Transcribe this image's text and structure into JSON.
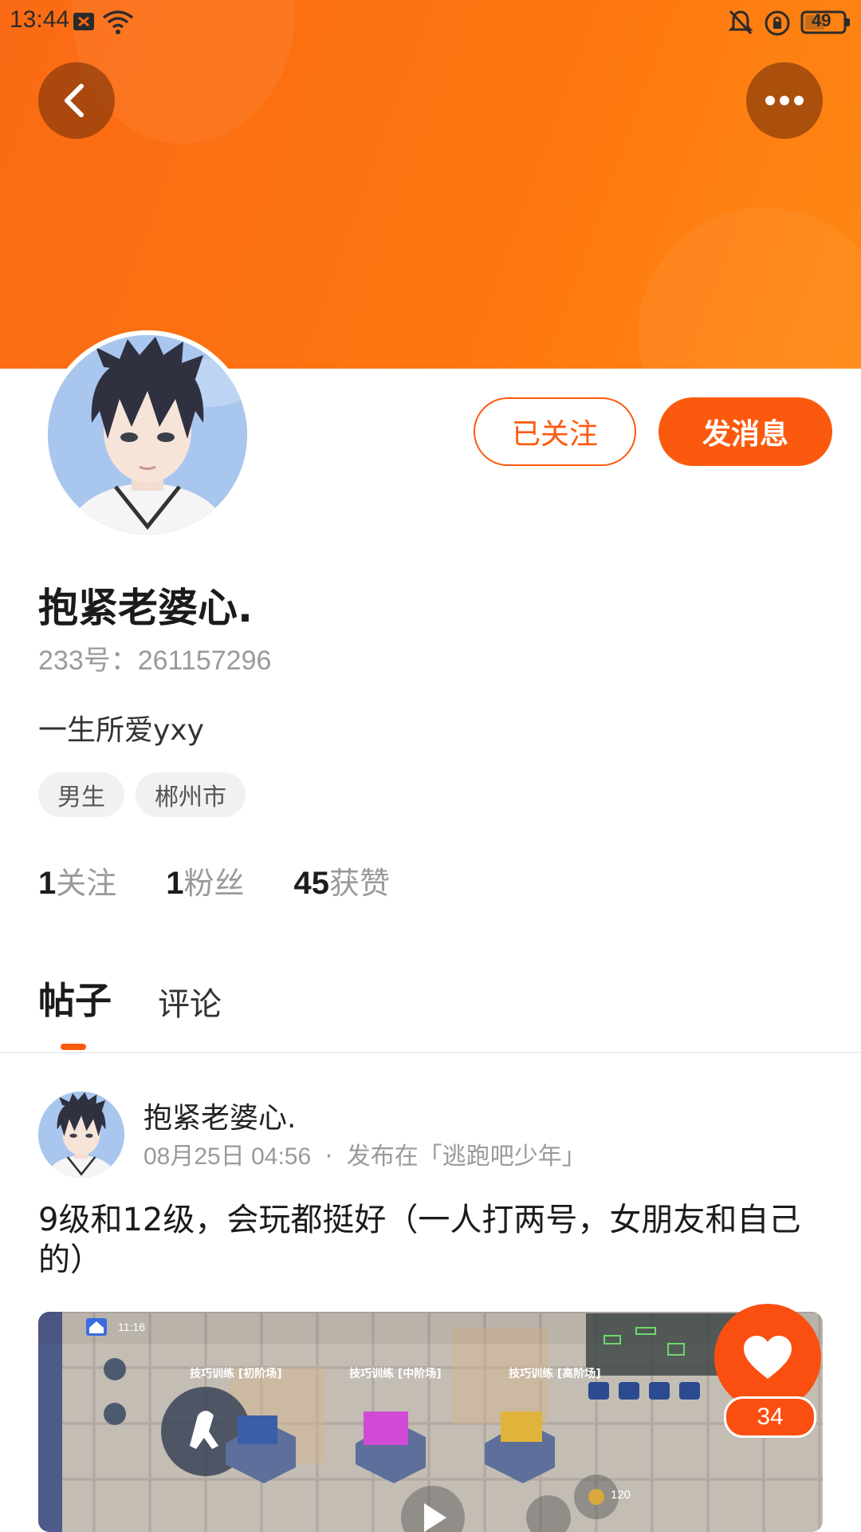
{
  "status_bar": {
    "time": "13:44",
    "battery": "49"
  },
  "header": {
    "back_icon": "chevron-left-icon",
    "more_icon": "more-horizontal-icon",
    "accent": "#fb5a0e"
  },
  "profile": {
    "name": "抱紧老婆心.",
    "id_label": "233号：",
    "id_value": "261157296",
    "bio": "一生所爱yxy",
    "tags": [
      "男生",
      "郴州市"
    ],
    "stats": [
      {
        "num": "1",
        "label": "关注"
      },
      {
        "num": "1",
        "label": "粉丝"
      },
      {
        "num": "45",
        "label": "获赞"
      }
    ]
  },
  "actions": {
    "followed": "已关注",
    "message": "发消息"
  },
  "tabs": [
    {
      "label": "帖子",
      "active": true
    },
    {
      "label": "评论",
      "active": false
    }
  ],
  "post": {
    "author": "抱紧老婆心.",
    "date": "08月25日 04:56",
    "separator": "·",
    "published_prefix": "发布在「逃跑吧少年」",
    "text": "9级和12级，会玩都挺好（一人打两号，女朋友和自己的）",
    "media": {
      "time": "11:16",
      "zone_labels": [
        "技巧训练 [初阶场]",
        "技巧训练 [中阶场]",
        "技巧训练 [高阶场]"
      ],
      "coins": "120"
    }
  },
  "like": {
    "count": "34"
  }
}
